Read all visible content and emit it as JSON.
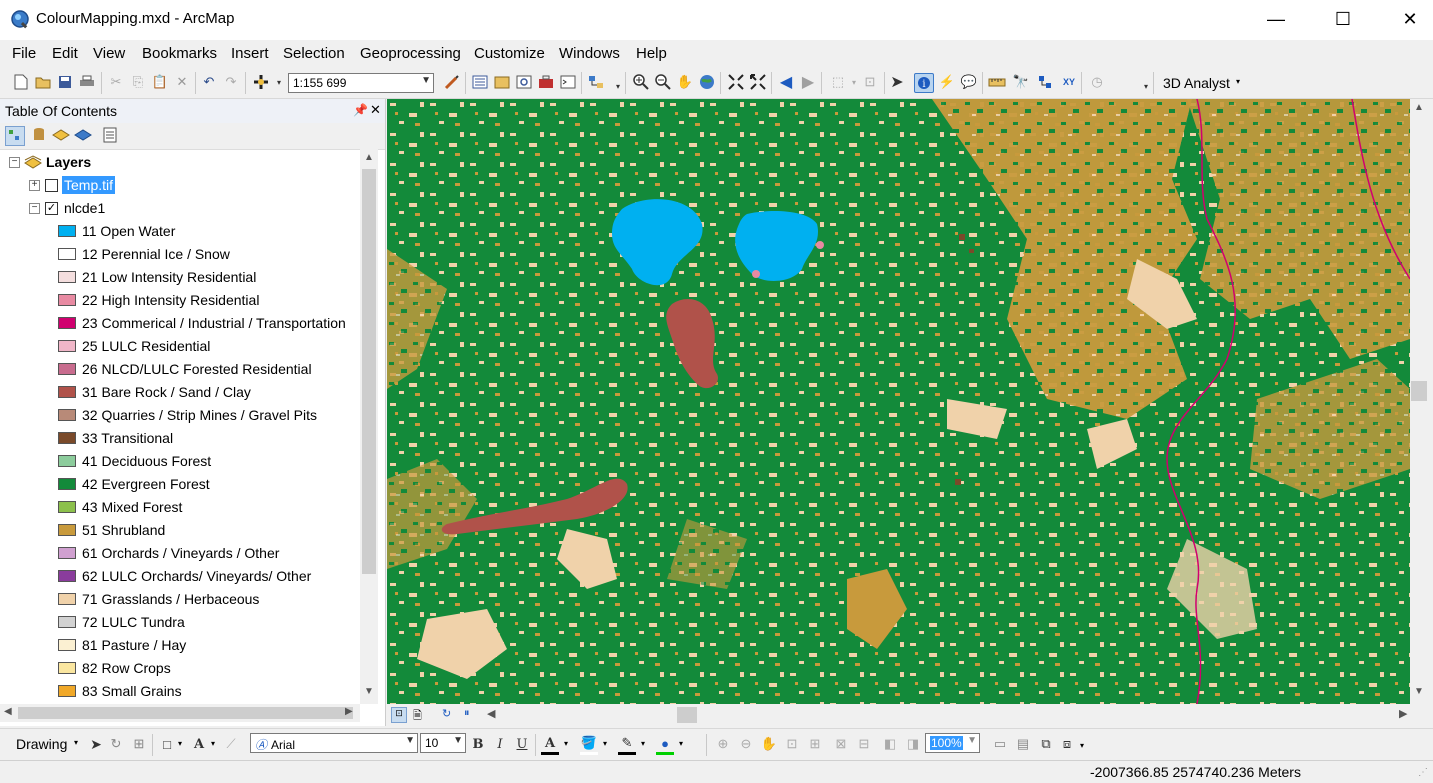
{
  "window": {
    "title": "ColourMapping.mxd - ArcMap",
    "minimize": "—",
    "maximize": "☐",
    "close": "✕"
  },
  "menu": [
    "File",
    "Edit",
    "View",
    "Bookmarks",
    "Insert",
    "Selection",
    "Geoprocessing",
    "Customize",
    "Windows",
    "Help"
  ],
  "toolbar": {
    "scale": "1:155 699",
    "analyst": "3D Analyst"
  },
  "toc": {
    "title": "Table Of Contents",
    "root": "Layers",
    "layers": [
      {
        "name": "Temp.tif",
        "checked": false,
        "expanded": false,
        "selected": true
      },
      {
        "name": "nlcde1",
        "checked": true,
        "expanded": true,
        "selected": false
      }
    ],
    "classes": [
      {
        "label": "11 Open Water",
        "color": "#00b0f0"
      },
      {
        "label": "12 Perennial Ice / Snow",
        "color": "#ffffff"
      },
      {
        "label": "21 Low Intensity Residential",
        "color": "#f4dede"
      },
      {
        "label": "22 High Intensity Residential",
        "color": "#e88aa2"
      },
      {
        "label": "23 Commerical / Industrial / Transportation",
        "color": "#d0006f"
      },
      {
        "label": "25 LULC Residential",
        "color": "#f0b6c8"
      },
      {
        "label": "26 NLCD/LULC Forested Residential",
        "color": "#c86c8e"
      },
      {
        "label": "31 Bare Rock / Sand / Clay",
        "color": "#b0524a"
      },
      {
        "label": "32 Quarries / Strip Mines / Gravel Pits",
        "color": "#b88a78"
      },
      {
        "label": "33 Transitional",
        "color": "#7a4a2a"
      },
      {
        "label": "41 Deciduous Forest",
        "color": "#8ccc9c"
      },
      {
        "label": "42 Evergreen Forest",
        "color": "#138a3a"
      },
      {
        "label": "43 Mixed Forest",
        "color": "#8cc04c"
      },
      {
        "label": "51 Shrubland",
        "color": "#c89a3c"
      },
      {
        "label": "61 Orchards / Vineyards / Other",
        "color": "#d0a0d0"
      },
      {
        "label": "62 LULC Orchards/ Vineyards/ Other",
        "color": "#8a3c9c"
      },
      {
        "label": "71 Grasslands / Herbaceous",
        "color": "#f0d2aa"
      },
      {
        "label": "72 LULC Tundra",
        "color": "#d2d2d2"
      },
      {
        "label": "81 Pasture / Hay",
        "color": "#fbf0d2"
      },
      {
        "label": "82 Row Crops",
        "color": "#fae6a0"
      },
      {
        "label": "83 Small Grains",
        "color": "#f0a828"
      }
    ]
  },
  "drawing": {
    "label": "Drawing",
    "font": "Arial",
    "size": "10",
    "bold": "B",
    "italic": "I",
    "underline": "U",
    "zoom": "100%"
  },
  "status": {
    "coords": "-2007366.85  2574740.236 Meters"
  }
}
